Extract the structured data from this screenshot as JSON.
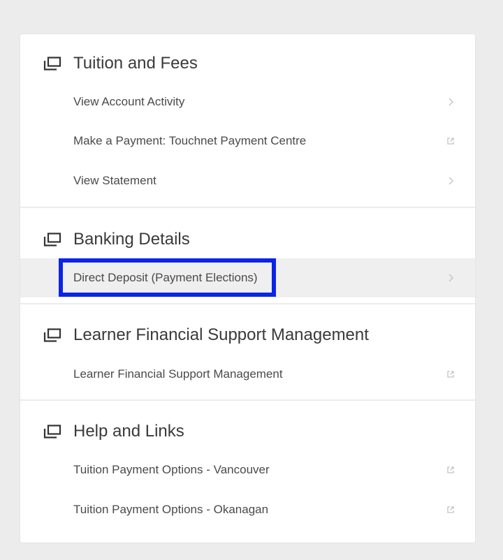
{
  "sections": [
    {
      "title": "Tuition and Fees",
      "icon": "window-stack-icon",
      "items": [
        {
          "label": "View Account Activity",
          "trail_icon": "chevron-right-icon"
        },
        {
          "label": "Make a Payment: Touchnet Payment Centre",
          "trail_icon": "external-link-icon"
        },
        {
          "label": "View Statement",
          "trail_icon": "chevron-right-icon"
        }
      ]
    },
    {
      "title": "Banking Details",
      "icon": "window-stack-icon",
      "items": [
        {
          "label": "Direct Deposit (Payment Elections)",
          "trail_icon": "chevron-right-icon",
          "highlighted": true
        }
      ]
    },
    {
      "title": "Learner Financial Support Management",
      "icon": "window-stack-icon",
      "items": [
        {
          "label": "Learner Financial Support Management",
          "trail_icon": "external-link-icon"
        }
      ]
    },
    {
      "title": "Help and Links",
      "icon": "window-stack-icon",
      "items": [
        {
          "label": "Tuition Payment Options - Vancouver",
          "trail_icon": "external-link-icon"
        },
        {
          "label": "Tuition Payment Options - Okanagan",
          "trail_icon": "external-link-icon"
        }
      ]
    }
  ],
  "colors": {
    "background": "#ececed",
    "card": "#ffffff",
    "highlight_border": "#0b24e8",
    "selected_row": "#efefef",
    "title_text": "#3a3a3a",
    "item_text": "#4a4a4a"
  }
}
